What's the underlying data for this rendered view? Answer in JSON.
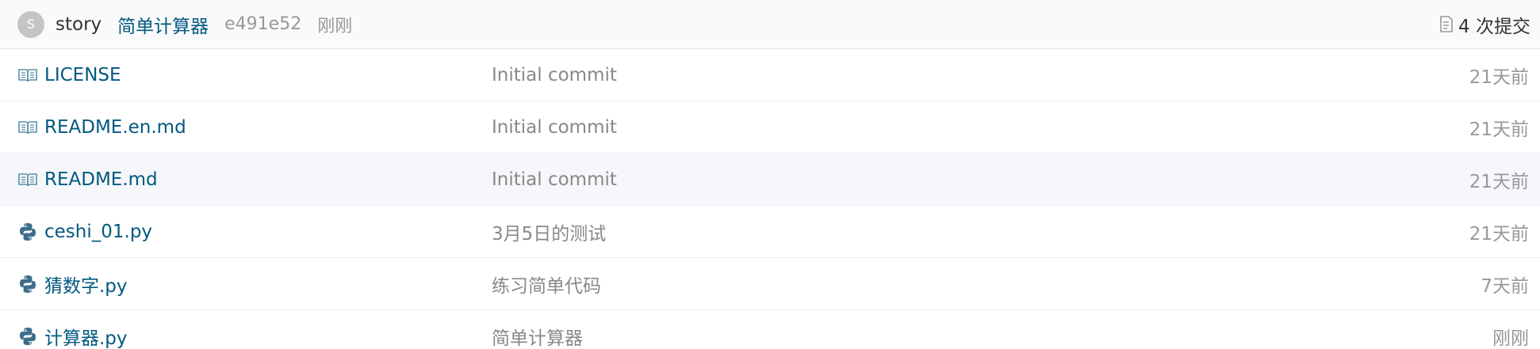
{
  "last_commit": {
    "avatar_letter": "S",
    "author": "story",
    "message": "简单计算器",
    "hash": "e491e52",
    "time": "刚刚",
    "commit_count_label": "4 次提交"
  },
  "files": [
    {
      "name": "LICENSE",
      "icon": "book-icon",
      "commit": "Initial commit",
      "time": "21天前"
    },
    {
      "name": "README.en.md",
      "icon": "book-icon",
      "commit": "Initial commit",
      "time": "21天前"
    },
    {
      "name": "README.md",
      "icon": "book-icon",
      "commit": "Initial commit",
      "time": "21天前"
    },
    {
      "name": "ceshi_01.py",
      "icon": "python-icon",
      "commit": "3月5日的测试",
      "time": "21天前"
    },
    {
      "name": "猜数字.py",
      "icon": "python-icon",
      "commit": "练习简单代码",
      "time": "7天前"
    },
    {
      "name": "计算器.py",
      "icon": "python-icon",
      "commit": "简单计算器",
      "time": "刚刚"
    }
  ],
  "colors": {
    "link": "#005980",
    "muted": "#999999",
    "icon": "#5b8fa8",
    "python": "#3d6e8c"
  }
}
